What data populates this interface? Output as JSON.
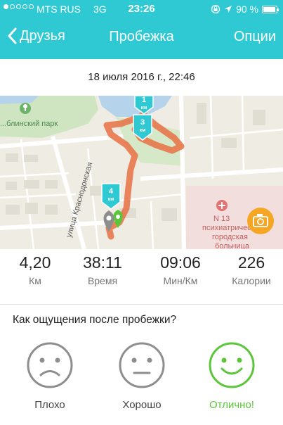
{
  "status_bar": {
    "carrier": "MTS RUS",
    "network": "3G",
    "time": "23:26",
    "battery": "90 %"
  },
  "nav": {
    "back_label": "Друзья",
    "title": "Пробежка",
    "options_label": "Опции"
  },
  "date": "18 июля 2016 г., 22:46",
  "map": {
    "park_label": "...блинский парк",
    "street_label": "улица Краснодонская",
    "hospital_label_1": "N 13",
    "hospital_label_2": "психиатрическ...",
    "hospital_label_3": "городская",
    "hospital_label_4": "больница",
    "km_markers": [
      {
        "num": "1",
        "unit": "км"
      },
      {
        "num": "3",
        "unit": "км"
      },
      {
        "num": "4",
        "unit": "км"
      }
    ],
    "route_color": "#e8774b",
    "marker_color": "#2fc9d3",
    "camera_color": "#f5a623"
  },
  "stats": [
    {
      "value": "4,20",
      "label": "Км"
    },
    {
      "value": "38:11",
      "label": "Время"
    },
    {
      "value": "09:06",
      "label": "Мин/Км"
    },
    {
      "value": "226",
      "label": "Калории"
    }
  ],
  "feeling": {
    "question": "Как ощущения после пробежки?",
    "options": [
      {
        "label": "Плохо",
        "icon": "sad-face-icon",
        "selected": false
      },
      {
        "label": "Хорошо",
        "icon": "neutral-face-icon",
        "selected": false
      },
      {
        "label": "Отлично!",
        "icon": "happy-face-icon",
        "selected": true
      }
    ]
  },
  "colors": {
    "header": "#2fc9d3",
    "selected": "#5cc63a",
    "unselected": "#8e8e8e"
  }
}
